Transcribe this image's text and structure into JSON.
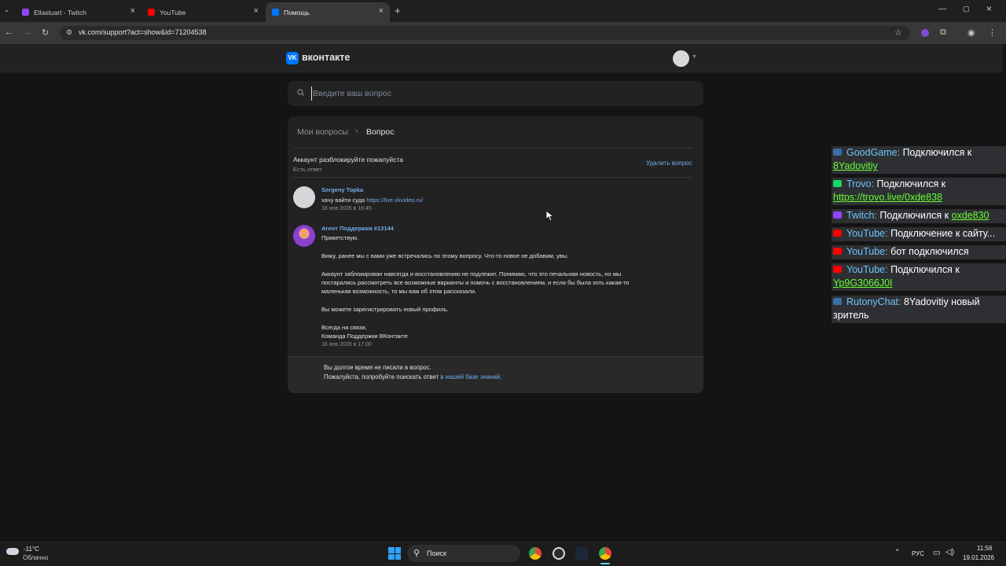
{
  "browser": {
    "tabs": [
      {
        "title": "Ellastuart - Twitch",
        "active": false,
        "favicon": "twitch-icon",
        "color": "#9146ff"
      },
      {
        "title": "YouTube",
        "active": false,
        "favicon": "youtube-icon",
        "color": "#ff0000"
      },
      {
        "title": "Помощь",
        "active": true,
        "favicon": "vk-icon",
        "color": "#0077ff"
      }
    ],
    "url": "vk.com/support?act=show&id=71204538"
  },
  "vk": {
    "brand": "вконтакте",
    "logo_text": "VK",
    "search_placeholder": "Введите ваш вопрос",
    "breadcrumb": {
      "parent": "Мои вопросы",
      "current": "Вопрос"
    },
    "question": {
      "title": "Аккаунт разблокируйте пожалуйста",
      "status": "Есть ответ",
      "delete_label": "Удалить вопрос"
    },
    "messages": [
      {
        "author": "Sergeny Topka",
        "text_prefix": "хачу вайти суда ",
        "link": "https://live.vkvideo.ru/",
        "date": "16 янв 2026 в 16:45"
      },
      {
        "author": "Агент Поддержки #13144",
        "lines": [
          "Приветствую.",
          "Вижу, ранее мы с вами уже встречались по этому вопросу. Что-то новое не добавим, увы.",
          "Аккаунт заблокирован навсегда и восстановлению не подлежит. Понимаю, что это печальная новость, но мы",
          "постарались рассмотреть все возможные варианты и помочь с восстановлением, и если бы была хоть какая-то",
          "маленькая возможность, то мы вам об этом рассказали.",
          "Вы можете зарегистрировать новый профиль.",
          "Всегда на связи,",
          "Команда Поддержки ВКонтакте"
        ],
        "date": "16 янв 2026 в 17:00"
      }
    ],
    "footer": {
      "line1": "Вы долгое время не писали в вопрос.",
      "line2_prefix": "Пожалуйста, попробуйте поискать ответ ",
      "line2_link": "в нашей базе знаний",
      "line2_suffix": "."
    }
  },
  "chat": [
    {
      "platform": "GoodGame:",
      "text": " Подключился к",
      "link": "8Yadovitiy",
      "icon_color": "#3a6ea8"
    },
    {
      "platform": "Trovo:",
      "text": " Подключился к",
      "link": "https://trovo.live/0xde838",
      "icon_color": "#19d66b"
    },
    {
      "platform": "Twitch:",
      "text": " Подключился к ",
      "link": "oxde830",
      "icon_color": "#9146ff"
    },
    {
      "platform": "YouTube:",
      "text": " Подключение к сайту...",
      "link": "",
      "icon_color": "#ff0000"
    },
    {
      "platform": "YouTube:",
      "text": " бот подключился",
      "link": "",
      "icon_color": "#ff0000"
    },
    {
      "platform": "YouTube:",
      "text": " Подключился к",
      "link": "Yp9G3066J0I",
      "icon_color": "#ff0000"
    },
    {
      "platform": "RutonyChat:",
      "text": " 8Yadovitiy новый",
      "text2": "зритель",
      "link": "",
      "icon_color": "#3a6ea8"
    }
  ],
  "taskbar": {
    "weather_temp": "-11°C",
    "weather_desc": "Облачно",
    "search_label": "Поиск",
    "lang": "РУС",
    "time": "11:56",
    "date": "19.01.2026"
  }
}
